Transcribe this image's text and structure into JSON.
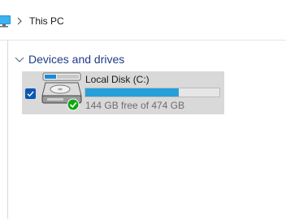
{
  "breadcrumb": {
    "location_icon": "monitor-icon",
    "separator_icon": "chevron-right-icon",
    "current": "This PC"
  },
  "group": {
    "chevron_icon": "chevron-down-icon",
    "title": "Devices and drives"
  },
  "drive": {
    "name": "Local Disk (C:)",
    "free_text": "144 GB free of 474 GB",
    "used_fraction": 0.696,
    "selected": true,
    "icon": "hard-drive-icon",
    "status_icon": "checkmark-badge-icon"
  },
  "colors": {
    "accent": "#26a0da",
    "group_title": "#1e3b8a",
    "checkbox": "#0a58b5",
    "tile_selected": "#d9d9d9"
  }
}
